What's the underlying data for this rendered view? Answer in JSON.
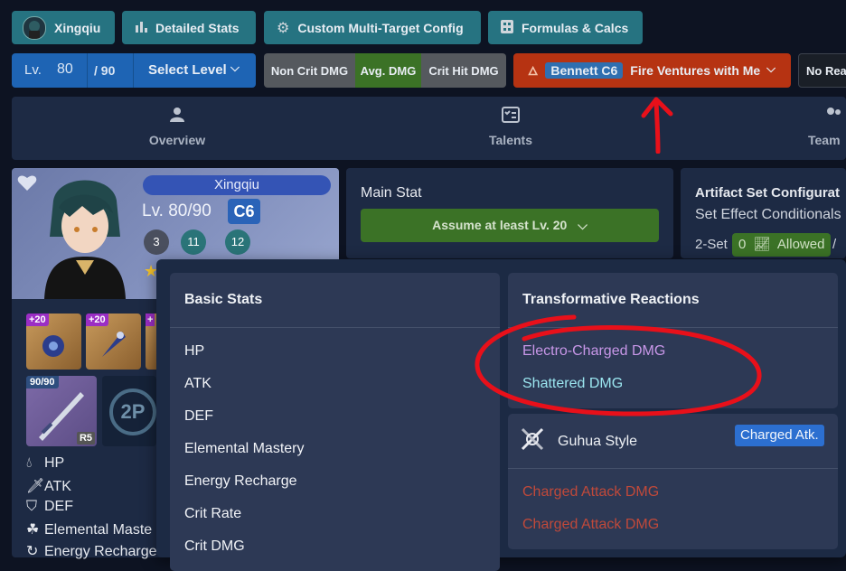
{
  "topbar": {
    "character": "Xingqiu",
    "detailed_stats": "Detailed Stats",
    "custom_multi": "Custom Multi-Target Config",
    "formulas": "Formulas & Calcs"
  },
  "level": {
    "prefix": "Lv.",
    "value": "80",
    "max": "/ 90",
    "select": "Select Level"
  },
  "crit_toggle": [
    "Non Crit DMG",
    "Avg. DMG",
    "Crit Hit DMG"
  ],
  "team_buff": {
    "name": "Bennett C6",
    "buff": "Fire Ventures with Me"
  },
  "reaction_btn": "No Rea",
  "tabs": {
    "overview": "Overview",
    "talents": "Talents",
    "team": "Team"
  },
  "char_card": {
    "name": "Xingqiu",
    "level": "Lv. 80/90",
    "constellation": "C6",
    "talents": [
      "3",
      "11",
      "12"
    ]
  },
  "artifacts": [
    "+20",
    "+20",
    "+"
  ],
  "weapon": {
    "level": "90/90",
    "refine": "R5",
    "logo": "2P"
  },
  "stat_list": [
    "HP",
    "ATK",
    "DEF",
    "Elemental Maste",
    "Energy Recharge"
  ],
  "main_stat": {
    "title": "Main Stat",
    "assume": "Assume at least Lv. 20"
  },
  "artifact_set": {
    "title": "Artifact Set Configurat",
    "subtitle": "Set Effect Conditionals",
    "two_set": "2-Set",
    "allowed_count": "0",
    "allowed": "Allowed",
    "sep": "/"
  },
  "dropdown": {
    "basic_title": "Basic Stats",
    "basic_items": [
      "HP",
      "ATK",
      "DEF",
      "Elemental Mastery",
      "Energy Recharge",
      "Crit Rate",
      "Crit DMG"
    ],
    "transform_title": "Transformative Reactions",
    "electro_charged": "Electro-Charged DMG",
    "shattered": "Shattered DMG",
    "guhua_title": "Guhua Style",
    "guhua_badge": "Charged Atk.",
    "guhua_items": [
      "Charged Attack DMG",
      "Charged Attack DMG"
    ]
  },
  "colors": {
    "electro": "#c897e8",
    "cryo": "#9be6f0",
    "physical_red": "#c0493a",
    "annotation": "#e8101a"
  }
}
